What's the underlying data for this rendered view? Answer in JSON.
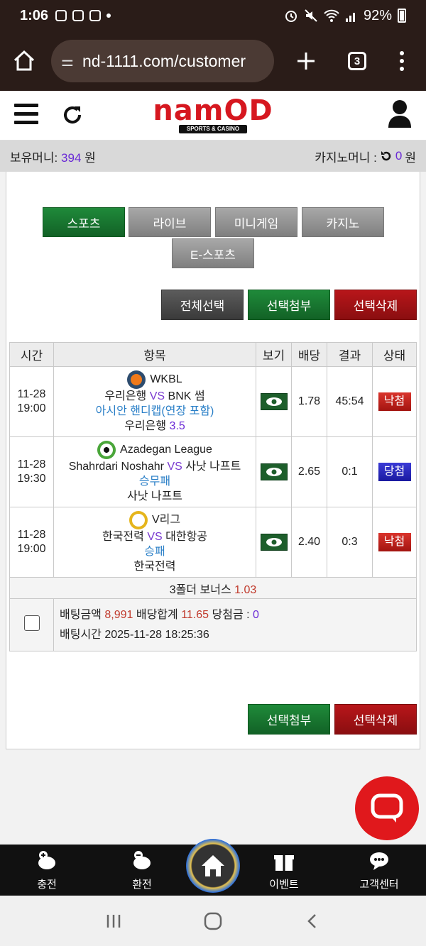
{
  "status": {
    "time": "1:06",
    "battery": "92%"
  },
  "browser": {
    "url": "nd-1111.com/customer",
    "tab_count": "3"
  },
  "header": {
    "logo_text": "namOD",
    "logo_sub": "SPORTS & CASINO"
  },
  "money": {
    "holding_label": "보유머니:",
    "holding_value": "394",
    "holding_unit": "원",
    "casino_label": "카지노머니 :",
    "casino_value": "0",
    "casino_unit": "원"
  },
  "tabs": [
    "스포츠",
    "라이브",
    "미니게임",
    "카지노",
    "E-스포츠"
  ],
  "actions": {
    "select_all": "전체선택",
    "attach": "선택첨부",
    "delete": "선택삭제"
  },
  "table": {
    "headers": [
      "시간",
      "항목",
      "보기",
      "배당",
      "결과",
      "상태"
    ],
    "rows": [
      {
        "date": "11-28",
        "time": "19:00",
        "sport": "basketball-icon",
        "league": "WKBL",
        "home": "우리은행",
        "vs": "VS",
        "away": "BNK 썸",
        "market": "아시안 핸디캡(연장 포함)",
        "pick": "우리은행",
        "pick_value": "3.5",
        "odds": "1.78",
        "result": "45:54",
        "status": "낙첨"
      },
      {
        "date": "11-28",
        "time": "19:30",
        "sport": "soccer-icon",
        "league": "Azadegan League",
        "home": "Shahrdari Noshahr",
        "vs": "VS",
        "away": "사낫 나프트",
        "market": "승무패",
        "pick": "사낫 나프트",
        "pick_value": "",
        "odds": "2.65",
        "result": "0:1",
        "status": "당첨"
      },
      {
        "date": "11-28",
        "time": "19:00",
        "sport": "volleyball-icon",
        "league": "V리그",
        "home": "한국전력",
        "vs": "VS",
        "away": "대한항공",
        "market": "승패",
        "pick": "한국전력",
        "pick_value": "",
        "odds": "2.40",
        "result": "0:3",
        "status": "낙첨"
      }
    ],
    "bonus_label": "3폴더 보너스",
    "bonus_value": "1.03",
    "summary": {
      "bet_amount_label": "배팅금액",
      "bet_amount": "8,991",
      "odds_total_label": "배당합계",
      "odds_total": "11.65",
      "win_label": "당첨금 :",
      "win_amount": "0",
      "bet_time_label": "배팅시간",
      "bet_time": "2025-11-28 18:25:36"
    }
  },
  "bottom_nav": {
    "charge": "충전",
    "exchange": "환전",
    "event": "이벤트",
    "support": "고객센터"
  },
  "colors": {
    "accent_green": "#1f8a3a",
    "accent_red": "#b8161a",
    "lose": "#d9342c",
    "win": "#3a3ad6"
  }
}
